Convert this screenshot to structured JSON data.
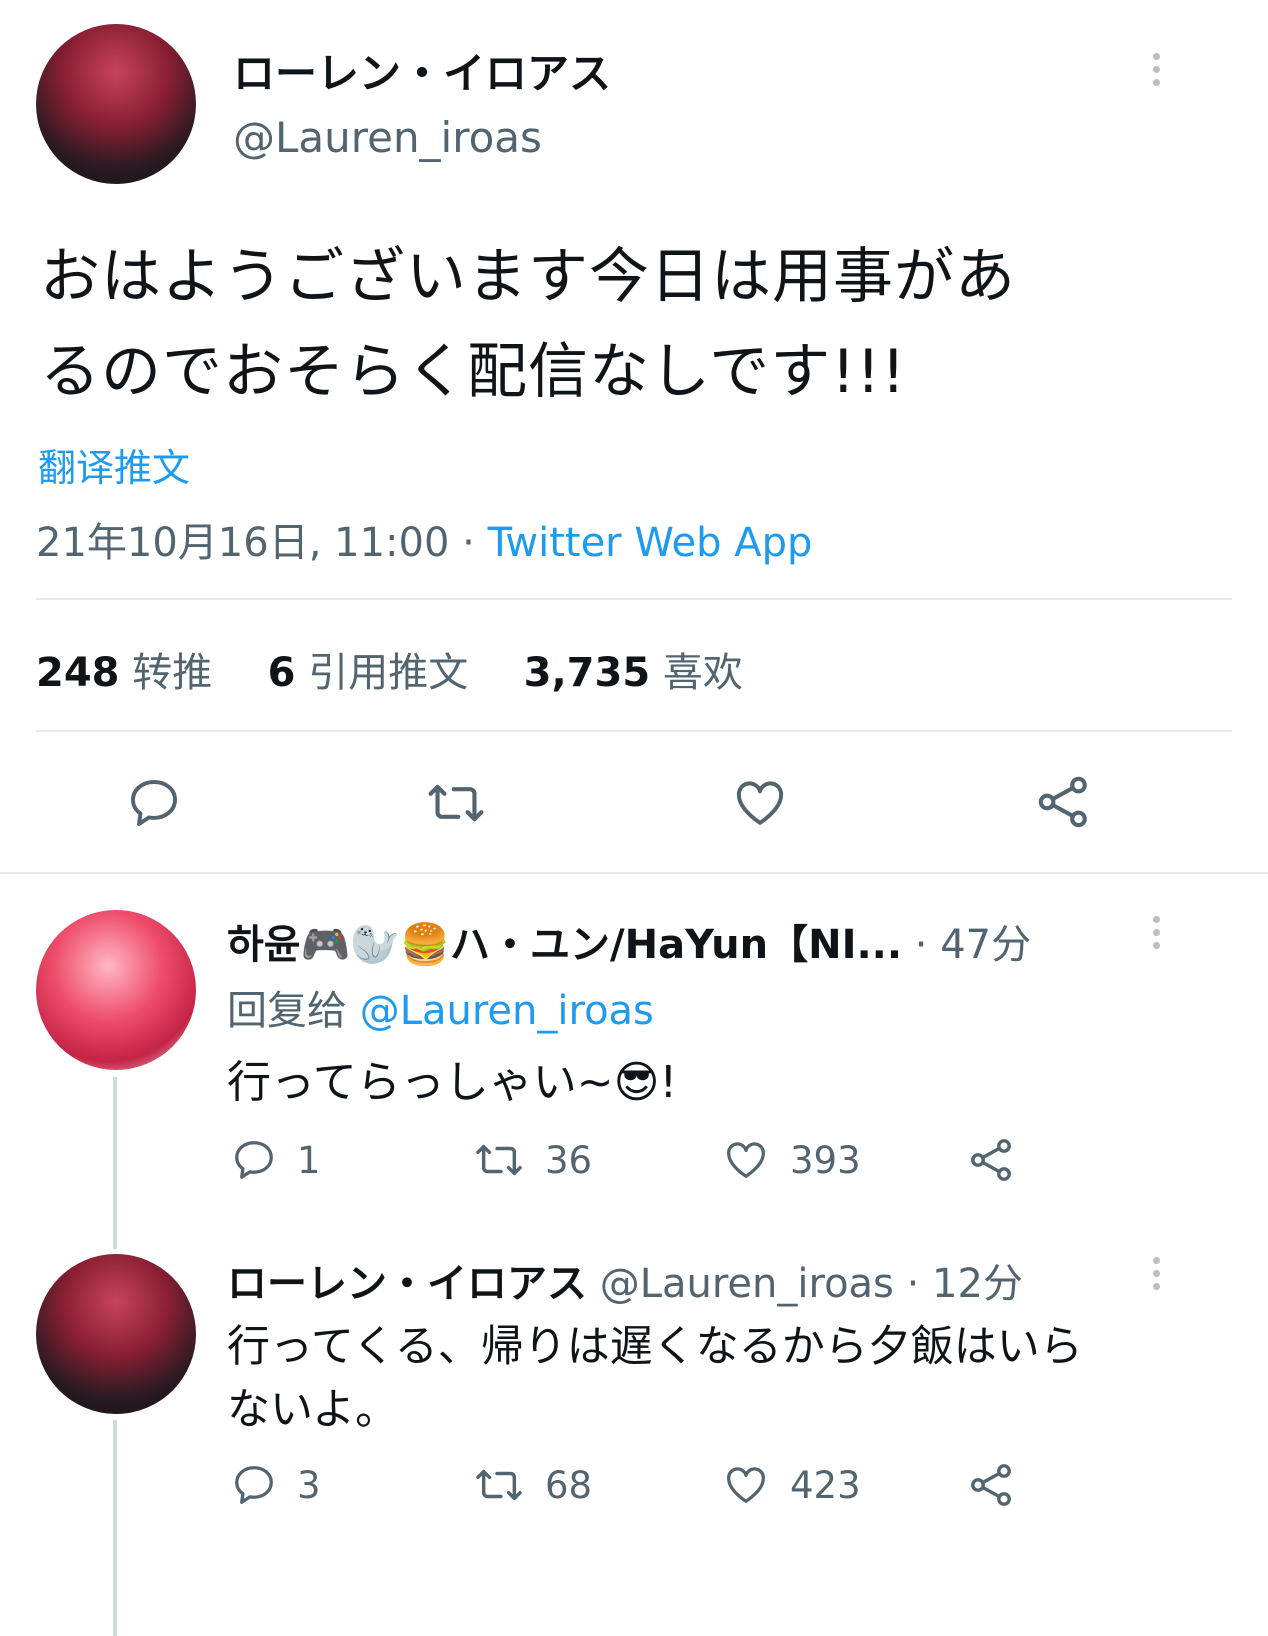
{
  "main_tweet": {
    "author_name": "ローレン・イロアス",
    "author_handle": "@Lauren_iroas",
    "text_line1": "おはようございます今日は用事があ",
    "text_line2": "るのでおそらく配信なしです!!!",
    "translate_label": "翻译推文",
    "timestamp": "21年10月16日, 11:00",
    "separator": "·",
    "source": "Twitter Web App",
    "retweets_count": "248",
    "retweets_label": "转推",
    "quotes_count": "6",
    "quotes_label": "引用推文",
    "likes_count": "3,735",
    "likes_label": "喜欢"
  },
  "replies": [
    {
      "author_name": "하윤🎮🦭🍔ハ・ユン/HaYun【NI...",
      "meta": "· 47分",
      "reply_to_label": "回复给",
      "reply_to_handle": "@Lauren_iroas",
      "text": "行ってらっしゃい~😎!",
      "reply_count": "1",
      "retweet_count": "36",
      "like_count": "393"
    },
    {
      "author_name": "ローレン・イロアス",
      "author_handle": "@Lauren_iroas",
      "meta": "· 12分",
      "text_line1": "行ってくる、帰りは遅くなるから夕飯はいら",
      "text_line2": "ないよ。",
      "reply_count": "3",
      "retweet_count": "68",
      "like_count": "423"
    }
  ],
  "colors": {
    "link": "#1d9bf0",
    "secondary_text": "#536471",
    "divider": "#e6e9ec"
  },
  "icons": [
    "more-dots-icon",
    "reply-icon",
    "retweet-icon",
    "like-icon",
    "share-icon"
  ]
}
